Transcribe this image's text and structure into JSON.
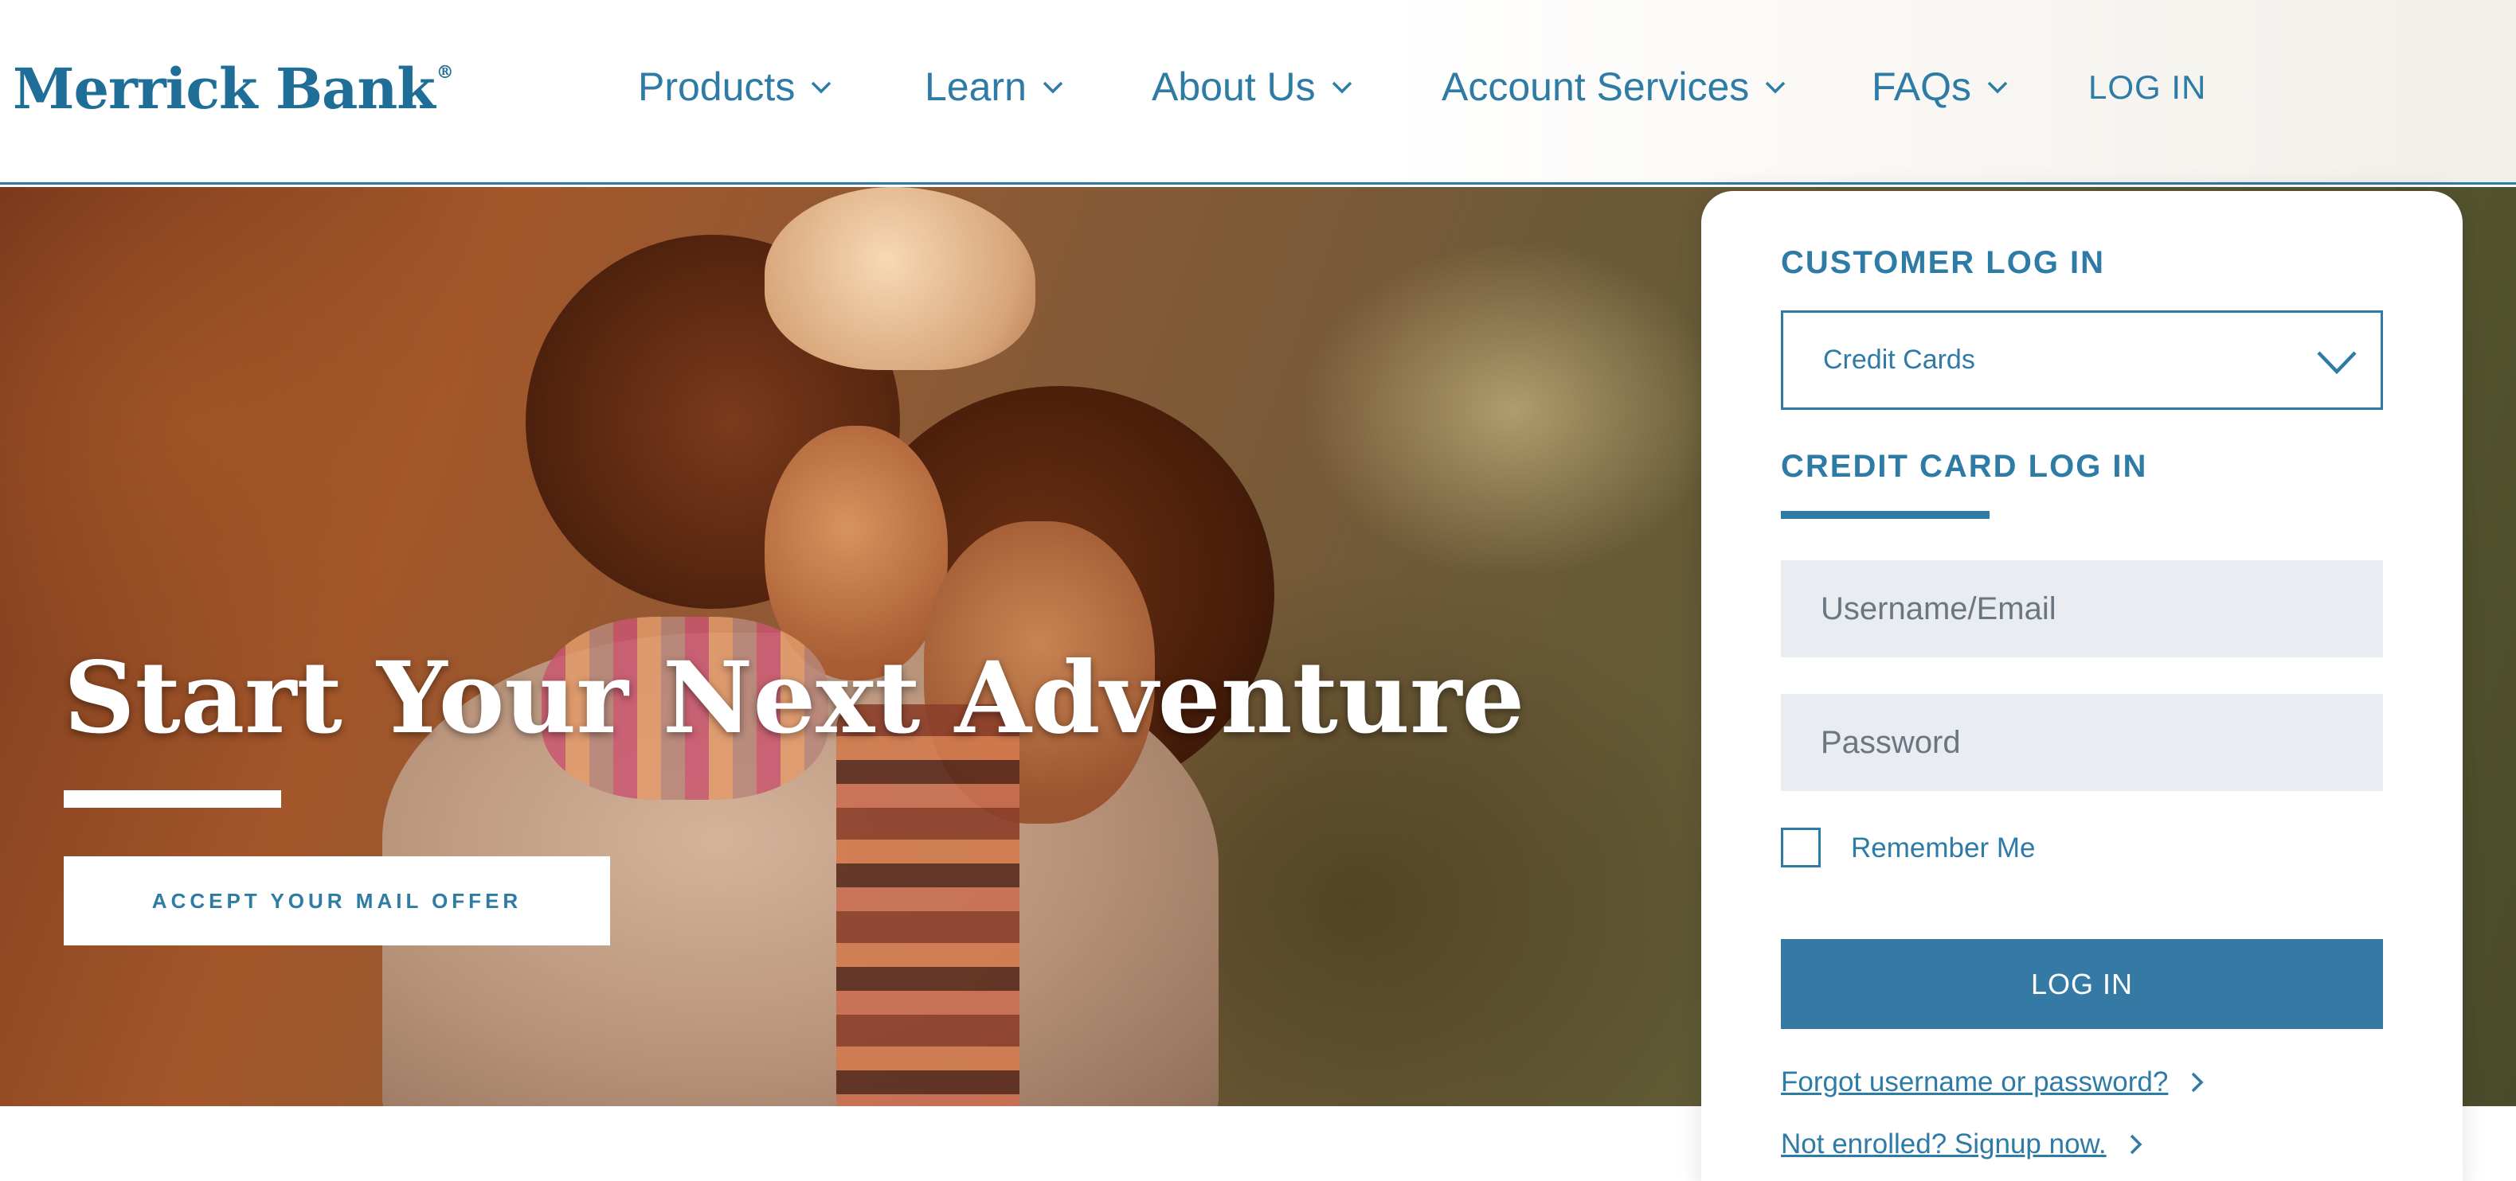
{
  "header": {
    "logo_text": "Merrick Bank",
    "logo_mark": "®",
    "nav": [
      {
        "label": "Products",
        "icon": "chevron-down-icon"
      },
      {
        "label": "Learn",
        "icon": "chevron-down-icon"
      },
      {
        "label": "About Us",
        "icon": "chevron-down-icon"
      },
      {
        "label": "Account Services",
        "icon": "chevron-down-icon"
      },
      {
        "label": "FAQs",
        "icon": "chevron-down-icon"
      }
    ],
    "login_label": "LOG IN"
  },
  "hero": {
    "title": "Start Your Next Adventure",
    "offer_button": "ACCEPT YOUR MAIL OFFER"
  },
  "login_panel": {
    "heading": "CUSTOMER LOG IN",
    "account_type": {
      "selected": "Credit Cards",
      "icon": "chevron-down-icon"
    },
    "subheading": "CREDIT CARD LOG IN",
    "username": {
      "value": "",
      "placeholder": "Username/Email"
    },
    "password": {
      "value": "",
      "placeholder": "Password"
    },
    "remember_me": {
      "label": "Remember Me",
      "checked": false
    },
    "login_button": "LOG IN",
    "links": [
      {
        "label": "Forgot username or password?",
        "icon": "chevron-right-icon"
      },
      {
        "label": "Not enrolled? Signup now.",
        "icon": "chevron-right-icon"
      }
    ]
  },
  "colors": {
    "brand": "#1e6e98",
    "accent": "#2e7ba6",
    "button": "#357aa5",
    "input_bg": "#e9ecf0"
  }
}
